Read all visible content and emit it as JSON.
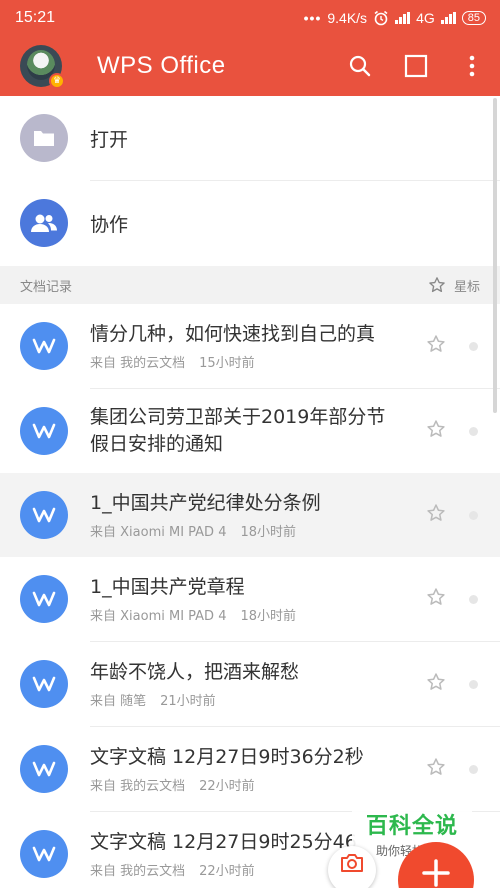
{
  "status_bar": {
    "time": "15:21",
    "network_speed": "9.4K/s",
    "network_type": "4G",
    "battery": "85"
  },
  "app_bar": {
    "title": "WPS Office"
  },
  "quick_actions": [
    {
      "label": "打开",
      "icon": "folder-icon",
      "color": "#b9b8cc"
    },
    {
      "label": "协作",
      "icon": "people-icon",
      "color": "#4c78dc"
    }
  ],
  "section": {
    "title": "文档记录",
    "star_label": "星标"
  },
  "documents": [
    {
      "title": "情分几种，如何快速找到自己的真",
      "source": "来自 我的云文档",
      "ago": "15小时前"
    },
    {
      "title": "集团公司劳卫部关于2019年部分节假日安排的通知",
      "source": "",
      "ago": ""
    },
    {
      "title": "1_中国共产党纪律处分条例",
      "source": "来自 Xiaomi MI PAD 4",
      "ago": "18小时前"
    },
    {
      "title": "1_中国共产党章程",
      "source": "来自 Xiaomi MI PAD 4",
      "ago": "18小时前"
    },
    {
      "title": "年龄不饶人，把酒来解愁",
      "source": "来自 随笔",
      "ago": "21小时前"
    },
    {
      "title": "文字文稿 12月27日9时36分2秒",
      "source": "来自 我的云文档",
      "ago": "22小时前"
    },
    {
      "title": "文字文稿 12月27日9时25分46",
      "source": "来自 我的云文档",
      "ago": "22小时前"
    }
  ],
  "watermark": {
    "title": "百科全说",
    "subtitle": "助你轻松解决"
  },
  "colors": {
    "brand_red": "#e9523e",
    "doc_icon_blue": "#4f8ff0",
    "fab_red": "#f04a2e"
  }
}
